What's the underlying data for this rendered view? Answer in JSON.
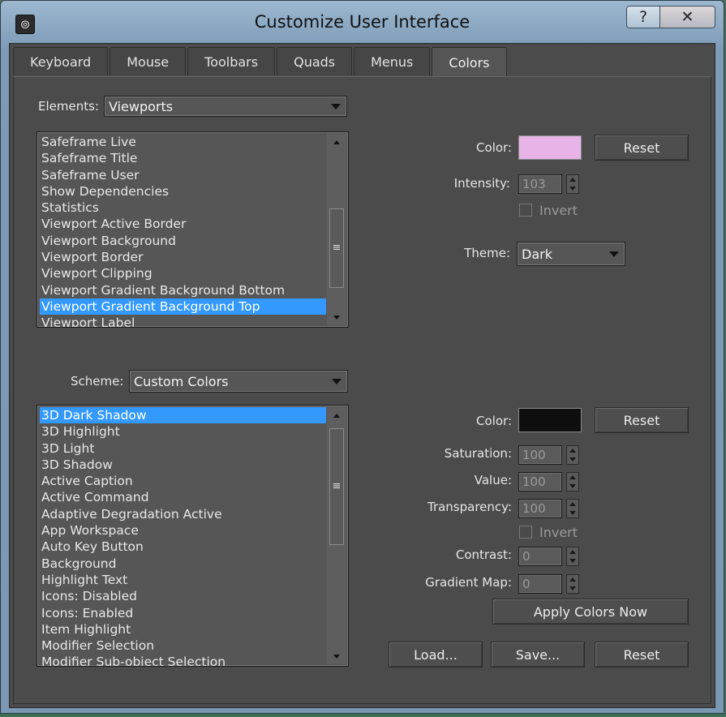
{
  "window": {
    "title": "Customize User Interface",
    "app_icon": "3ds-max-logo-icon",
    "help_label": "?",
    "close_label": "✕"
  },
  "tabs": [
    {
      "label": "Keyboard",
      "active": false
    },
    {
      "label": "Mouse",
      "active": false
    },
    {
      "label": "Toolbars",
      "active": false
    },
    {
      "label": "Quads",
      "active": false
    },
    {
      "label": "Menus",
      "active": false
    },
    {
      "label": "Colors",
      "active": true
    }
  ],
  "elements": {
    "label": "Elements:",
    "value": "Viewports",
    "items": [
      "Safeframe Live",
      "Safeframe Title",
      "Safeframe User",
      "Show Dependencies",
      "Statistics",
      "Viewport Active Border",
      "Viewport Background",
      "Viewport Border",
      "Viewport Clipping",
      "Viewport Gradient Background Bottom",
      "Viewport Gradient Background Top",
      "Viewport Label"
    ],
    "selected_index": 10
  },
  "element_color": {
    "color_label": "Color:",
    "color_value": "#e8b4e8",
    "reset_label": "Reset",
    "intensity_label": "Intensity:",
    "intensity_value": "103",
    "invert_label": "Invert",
    "theme_label": "Theme:",
    "theme_value": "Dark"
  },
  "scheme": {
    "label": "Scheme:",
    "value": "Custom Colors",
    "items": [
      "3D Dark Shadow",
      "3D Highlight",
      "3D Light",
      "3D Shadow",
      "Active Caption",
      "Active Command",
      "Adaptive Degradation Active",
      "App Workspace",
      "Auto Key Button",
      "Background",
      "Highlight Text",
      "Icons: Disabled",
      "Icons: Enabled",
      "Item Highlight",
      "Modifier Selection",
      "Modifier Sub-object Selection"
    ],
    "selected_index": 0
  },
  "scheme_color": {
    "color_label": "Color:",
    "color_value": "#0e0e0e",
    "reset_label": "Reset",
    "saturation_label": "Saturation:",
    "saturation_value": "100",
    "value_label": "Value:",
    "value_value": "100",
    "transparency_label": "Transparency:",
    "transparency_value": "100",
    "invert_label": "Invert",
    "contrast_label": "Contrast:",
    "contrast_value": "0",
    "gradient_label": "Gradient Map:",
    "gradient_value": "0",
    "apply_label": "Apply Colors Now"
  },
  "footer": {
    "load_label": "Load...",
    "save_label": "Save...",
    "reset_label": "Reset"
  }
}
